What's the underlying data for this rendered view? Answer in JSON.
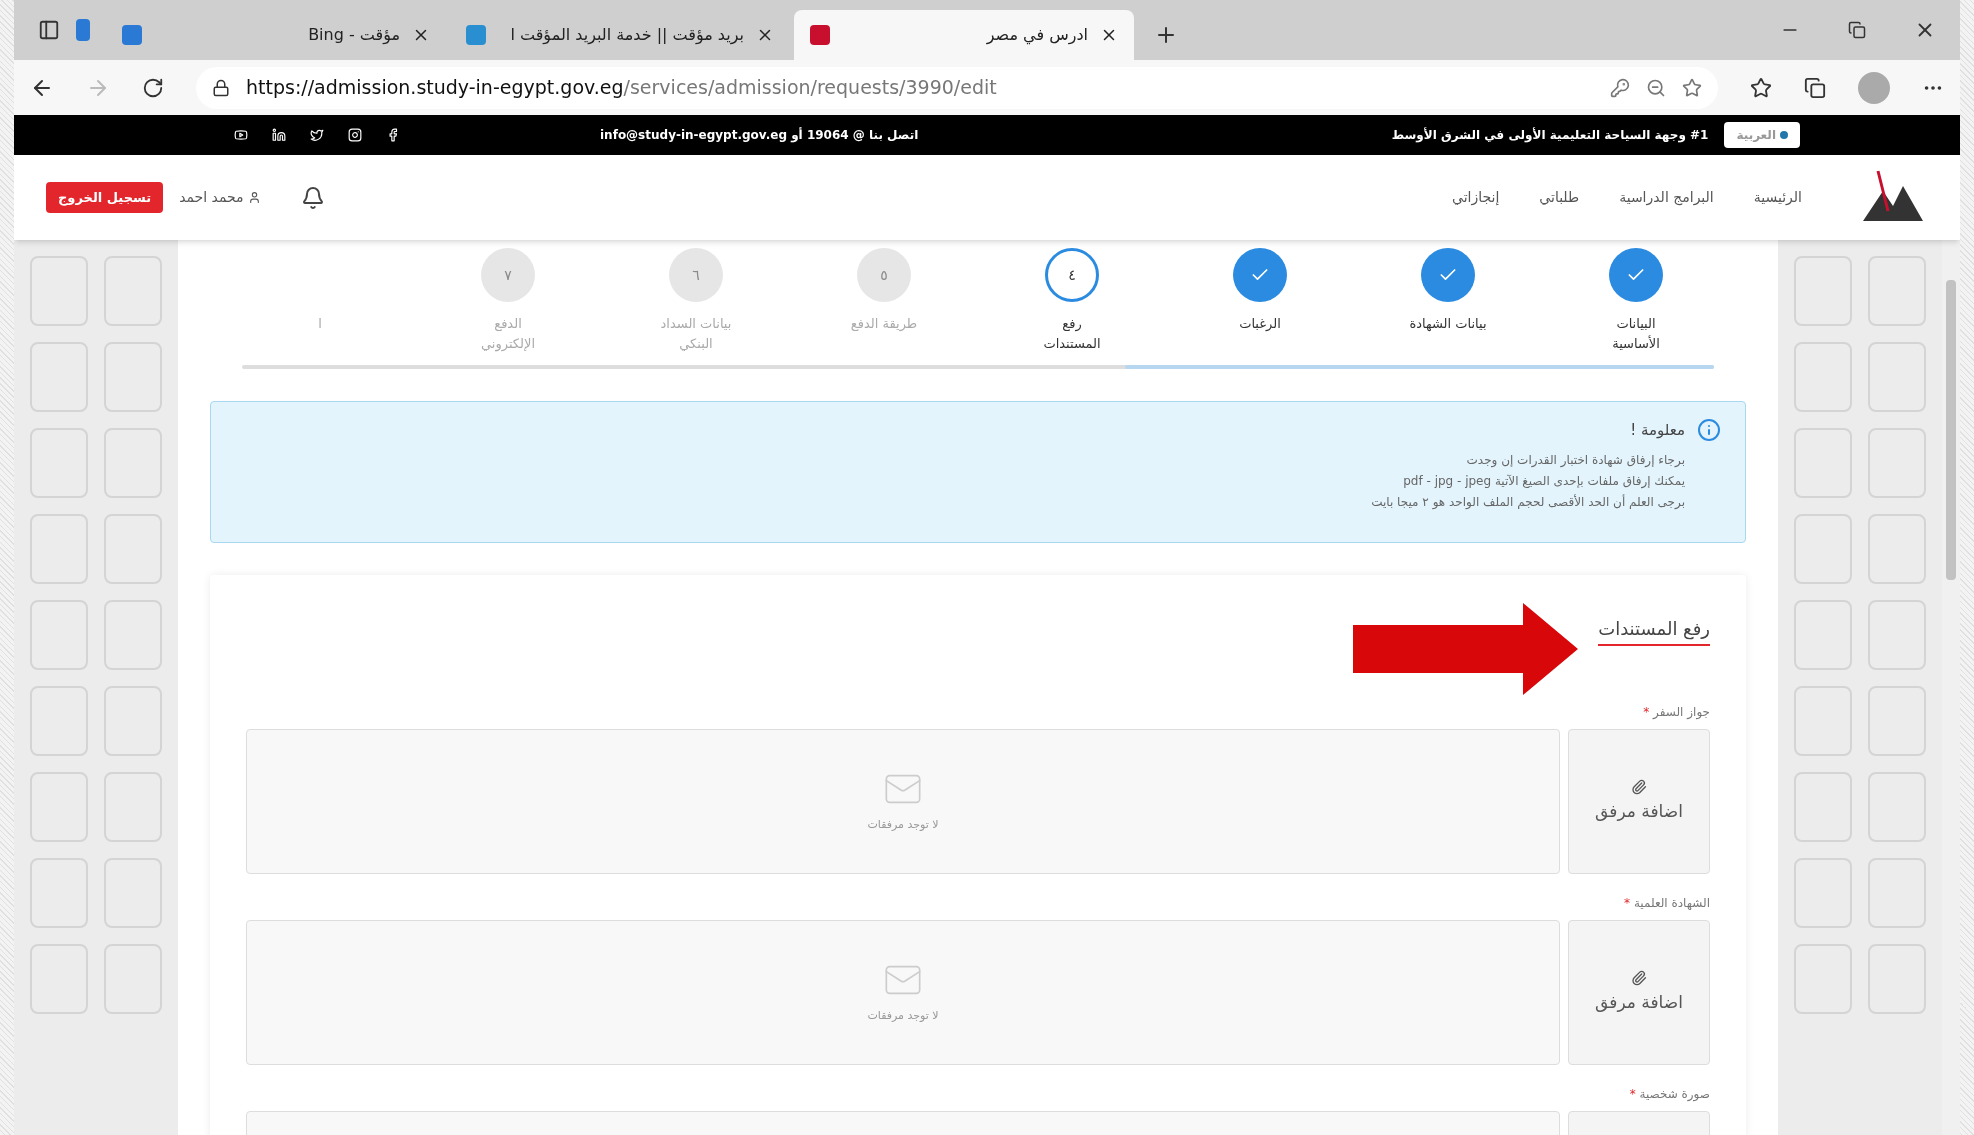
{
  "browser": {
    "tabs": [
      {
        "title": "ادرس في مصر",
        "selected": true
      },
      {
        "title": "بريد مؤقت || خدمة البريد المؤقت ا",
        "selected": false
      },
      {
        "title": "مؤقت - Bing",
        "selected": false
      }
    ],
    "url_host": "https://admission.study-in-egypt.gov.eg",
    "url_path": "/services/admission/requests/3990/edit"
  },
  "topbar": {
    "language": "العربية",
    "slogan": "#1 وجهة السياحة التعليمية الأولى في الشرق الأوسط",
    "contact": "اتصل بنا @ 19064 أو info@study-in-egypt.gov.eg"
  },
  "header": {
    "nav": [
      "الرئيسية",
      "البرامج الدراسية",
      "طلباتي",
      "إنجازاتي"
    ],
    "user": "محمد احمد",
    "logout": "تسجيل الخروج"
  },
  "stepper": {
    "level": 0.4,
    "steps": [
      {
        "label": "البيانات الأساسية",
        "completed": true,
        "selected": false
      },
      {
        "label": "بيانات الشهادة",
        "completed": true,
        "selected": false
      },
      {
        "label": "الرغبات",
        "completed": true,
        "selected": false
      },
      {
        "number": "٤",
        "label": "رفع المستندات",
        "completed": false,
        "selected": true
      },
      {
        "number": "٥",
        "label": "طريقة الدفع",
        "completed": false,
        "selected": false
      },
      {
        "number": "٦",
        "label": "بيانات السداد البنكي",
        "completed": false,
        "selected": false
      },
      {
        "number": "٧",
        "label": "الدفع الإلكتروني",
        "completed": false,
        "selected": false
      },
      {
        "label": "ا"
      }
    ]
  },
  "info": {
    "title": "معلومة !",
    "lines": [
      "برجاء إرفاق شهادة اختبار القدرات إن وجدت",
      "يمكنك إرفاق ملفات بإحدى الصيغ الآتية pdf - jpg - jpeg",
      "برجى العلم أن الحد الأقصى لحجم الملف الواحد هو ٢ ميجا بايت"
    ]
  },
  "upload": {
    "title": "رفع المستندات",
    "fields": [
      {
        "label": "جواز السفر",
        "required_mark": "*",
        "button": "اضافة مرفق",
        "empty": "لا توجد مرفقات"
      },
      {
        "label": "الشهادة العلمية",
        "required_mark": "*",
        "button": "اضافة مرفق",
        "empty": "لا توجد مرفقات"
      },
      {
        "label": "صورة شخصية",
        "required_mark": "*"
      }
    ]
  }
}
